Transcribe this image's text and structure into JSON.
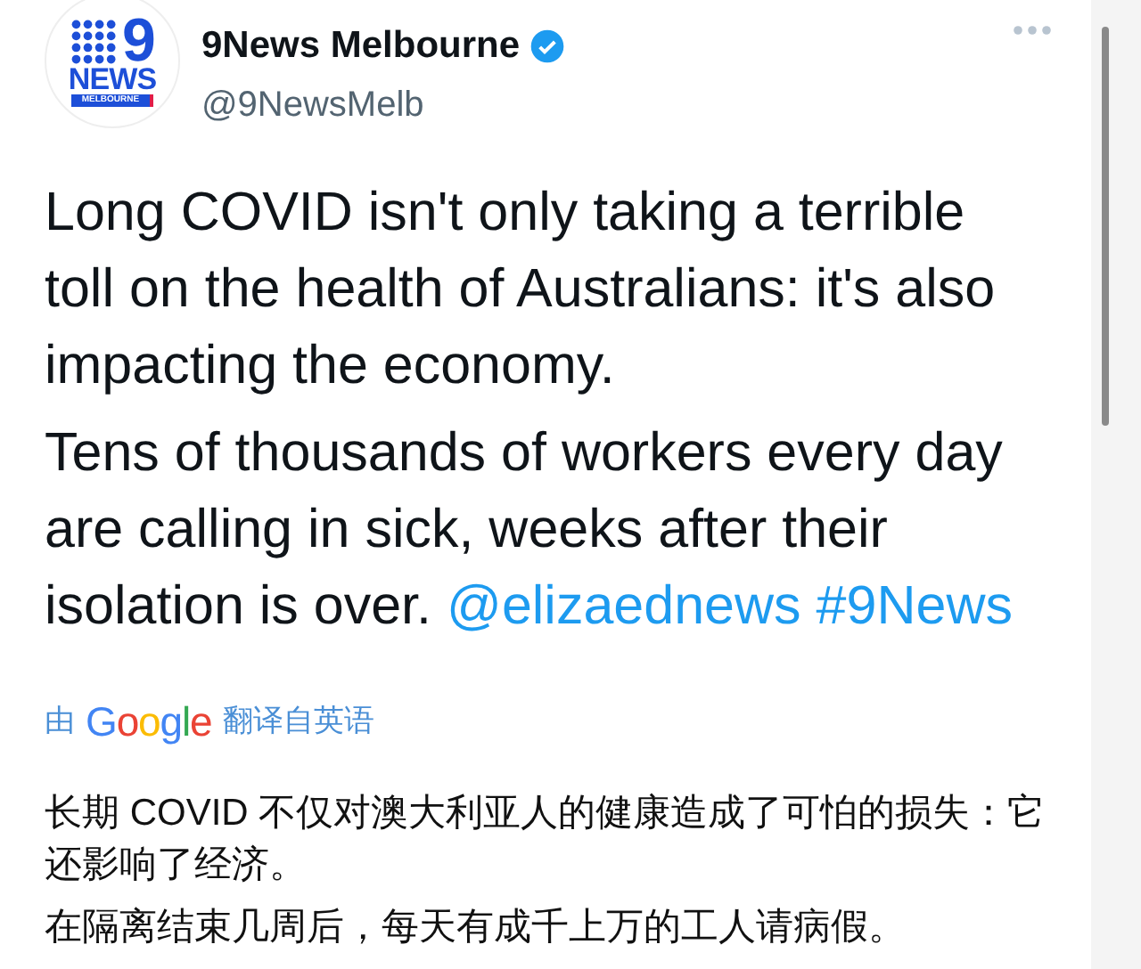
{
  "account": {
    "name": "9News Melbourne",
    "verified": true,
    "handle": "@9NewsMelb",
    "logo": {
      "numeral": "9",
      "word": "NEWS",
      "sub": "MELBOURNE"
    }
  },
  "tweet": {
    "paragraphs": [
      {
        "text": "Long COVID isn't only taking a terrible toll on the health of Australians: it's also impacting the economy."
      },
      {
        "text": "Tens of thousands of workers every day are calling in sick, weeks after their isolation is over.",
        "links": [
          "@elizaednews",
          "#9News"
        ]
      }
    ]
  },
  "translation": {
    "prefix": "由",
    "brand": "Google",
    "suffix": "翻译自英语",
    "paragraphs": [
      "长期 COVID 不仅对澳大利亚人的健康造成了可怕的损失：它还影响了经济。",
      "在隔离结束几周后，每天有成千上万的工人请病假。"
    ]
  }
}
